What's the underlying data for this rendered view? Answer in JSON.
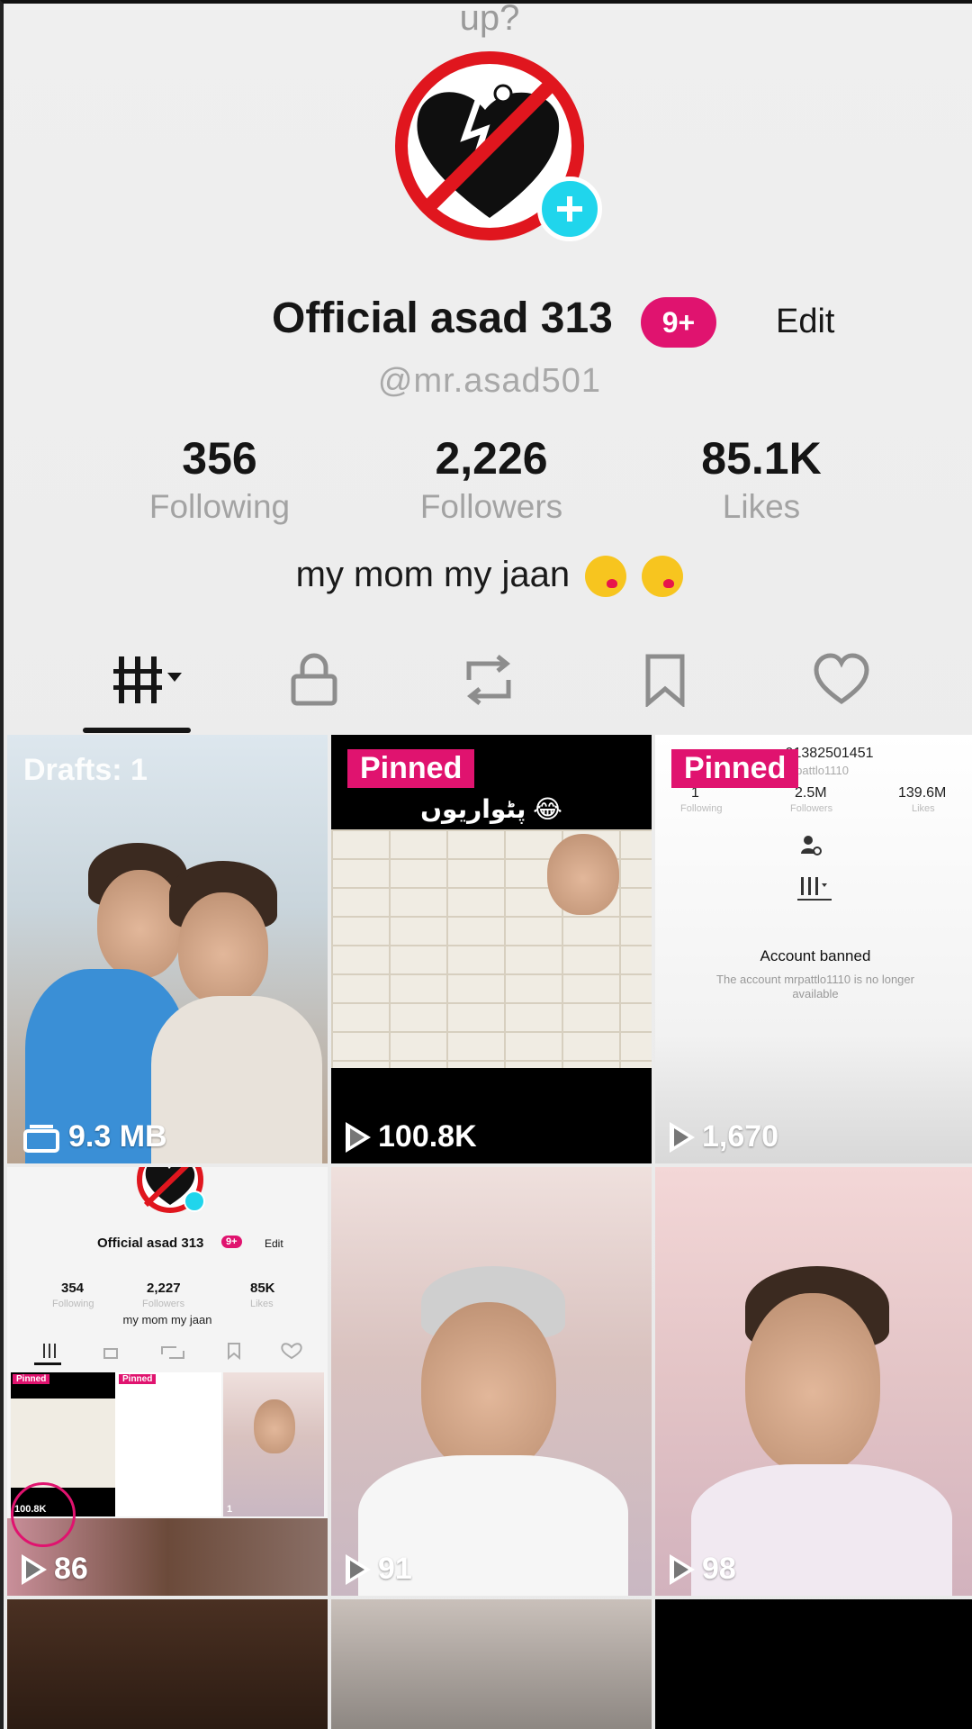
{
  "header": {
    "cut_text": "up?"
  },
  "profile": {
    "name": "Official asad 313",
    "badge": "9+",
    "edit_label": "Edit",
    "handle": "@mr.asad501",
    "bio": "my mom my jaan",
    "stats": [
      {
        "value": "356",
        "label": "Following"
      },
      {
        "value": "2,226",
        "label": "Followers"
      },
      {
        "value": "85.1K",
        "label": "Likes"
      }
    ]
  },
  "tabs": [
    {
      "icon": "videos-grid-icon",
      "active": true
    },
    {
      "icon": "lock-icon",
      "active": false
    },
    {
      "icon": "repost-icon",
      "active": false
    },
    {
      "icon": "bookmark-icon",
      "active": false
    },
    {
      "icon": "heart-icon",
      "active": false
    }
  ],
  "grid": {
    "drafts": {
      "label": "Drafts: 1",
      "size": "9.3 MB"
    },
    "tiles": [
      {
        "pinned": "Pinned",
        "caption": "پٹواریوں 😂",
        "views": "100.8K"
      },
      {
        "pinned": "Pinned",
        "views": "1,670",
        "banned_account": {
          "handle": "user91382501451",
          "sub": "mrpattlo1110",
          "stats": [
            {
              "value": "1",
              "label": "Following"
            },
            {
              "value": "2.5M",
              "label": "Followers"
            },
            {
              "value": "139.6M",
              "label": "Likes"
            }
          ],
          "title": "Account banned",
          "message": "The account mrpattlo1110 is no longer available"
        }
      },
      {
        "views": "86",
        "mini_profile": {
          "name": "Official asad 313",
          "badge": "9+",
          "edit": "Edit",
          "stats": [
            {
              "value": "354",
              "label": "Following"
            },
            {
              "value": "2,227",
              "label": "Followers"
            },
            {
              "value": "85K",
              "label": "Likes"
            }
          ],
          "bio": "my mom my jaan",
          "pinned": "Pinned",
          "views_a": "100.8K",
          "views_b": "1"
        }
      },
      {
        "views": "91"
      },
      {
        "views": "98"
      }
    ]
  },
  "colors": {
    "accent": "#e0136f",
    "add": "#20d5ec",
    "ban_red": "#e0161e"
  }
}
